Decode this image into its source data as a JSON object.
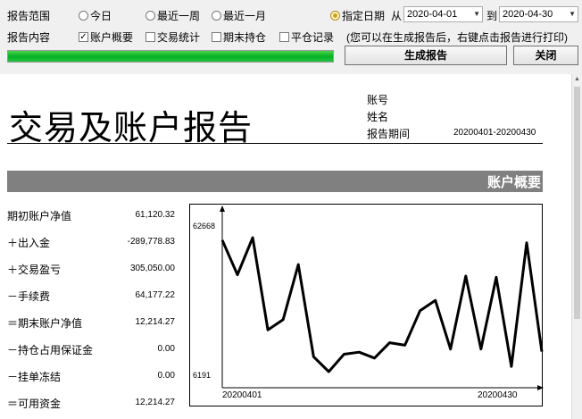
{
  "controls": {
    "range_label": "报告范围",
    "radios": [
      "今日",
      "最近一周",
      "最近一月"
    ],
    "specify_label": "指定日期",
    "from_label": "从",
    "to_label": "到",
    "date_from": "2020-04-01",
    "date_to": "2020-04-30",
    "content_label": "报告内容",
    "checks": [
      {
        "label": "账户概要",
        "checked": true
      },
      {
        "label": "交易统计",
        "checked": false
      },
      {
        "label": "期末持仓",
        "checked": false
      },
      {
        "label": "平仓记录",
        "checked": false
      }
    ],
    "hint": "(您可以在生成报告后，右键点击报告进行打印)",
    "progress": 1.0,
    "generate_btn": "生成报告",
    "close_btn": "关闭"
  },
  "report": {
    "title": "交易及账户报告",
    "account_label": "账号",
    "name_label": "姓名",
    "period_label": "报告期间",
    "period_value": "20200401-20200430",
    "section_title": "账户概要",
    "rows": [
      {
        "label": "期初账户净值",
        "value": "61,120.32"
      },
      {
        "label": "＋出入金",
        "value": "-289,778.83"
      },
      {
        "label": "＋交易盈亏",
        "value": "305,050.00"
      },
      {
        "label": "－手续费",
        "value": "64,177.22"
      },
      {
        "label": "＝期末账户净值",
        "value": "12,214.27"
      },
      {
        "label": "－持仓占用保证金",
        "value": "0.00"
      },
      {
        "label": "－挂单冻结",
        "value": "0.00"
      },
      {
        "label": "＝可用资金",
        "value": "12,214.27"
      }
    ]
  },
  "chart_data": {
    "type": "line",
    "x_start_label": "20200401",
    "x_end_label": "20200430",
    "y_max_label": "62668",
    "y_min_label": "6191",
    "ylim": [
      6191,
      62668
    ],
    "values": [
      57500,
      44000,
      58500,
      22500,
      26500,
      48000,
      12000,
      6191,
      13000,
      13800,
      11500,
      17500,
      16500,
      30000,
      34000,
      15000,
      43500,
      15000,
      43000,
      8200,
      56500,
      14000
    ]
  }
}
